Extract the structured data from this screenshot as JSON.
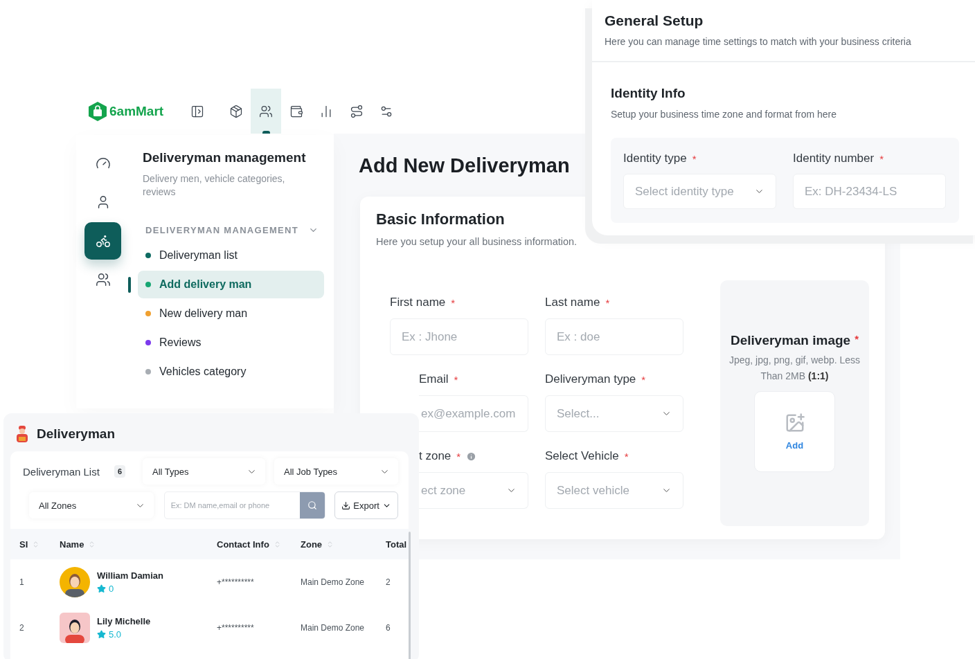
{
  "top_nav": {
    "logo": "6amMart",
    "items": [
      {
        "selected": false
      },
      {
        "selected": false
      },
      {
        "selected": true
      },
      {
        "selected": false
      },
      {
        "selected": false
      },
      {
        "selected": false
      },
      {
        "selected": false
      }
    ]
  },
  "icon_rail": {
    "items": [
      {
        "selected": false
      },
      {
        "selected": false
      },
      {
        "selected": true
      },
      {
        "selected": false
      }
    ]
  },
  "sidebar": {
    "title": "Deliveryman management",
    "subtitle": "Delivery men, vehicle categories, reviews",
    "section": {
      "label": "DELIVERYMAN MANAGEMENT",
      "expanded": true
    },
    "items": [
      {
        "label": "Deliveryman list",
        "color": "#0f6b62",
        "selected": false
      },
      {
        "label": "Add delivery man",
        "color": "#17a673",
        "selected": true
      },
      {
        "label": "New delivery man",
        "color": "#f0a030",
        "selected": false
      },
      {
        "label": "Reviews",
        "color": "#7c3aed",
        "selected": false
      },
      {
        "label": "Vehicles category",
        "color": "#a8adb3",
        "selected": false
      }
    ]
  },
  "form": {
    "title": "Add New Deliveryman",
    "card": {
      "title": "Basic Information",
      "subtitle": "Here you setup your all business information.",
      "fields": [
        {
          "label": "First name",
          "required": "*",
          "kind": "input",
          "placeholder": "Ex : Jhone",
          "clipped": false
        },
        {
          "label": "Last name",
          "required": "*",
          "kind": "input",
          "placeholder": "Ex : doe",
          "clipped": false
        },
        {
          "label": "Email",
          "required": "*",
          "kind": "input",
          "placeholder": "ex@example.com",
          "clipped": true
        },
        {
          "label": "Deliveryman type",
          "required": "*",
          "kind": "select",
          "placeholder": "Select...",
          "clipped": false
        },
        {
          "label": "t zone",
          "required": "*",
          "kind": "select",
          "placeholder": "ect zone",
          "clipped": true,
          "info": true
        },
        {
          "label": "Select Vehicle",
          "required": "*",
          "kind": "select",
          "placeholder": "Select vehicle",
          "clipped": false
        }
      ],
      "image": {
        "label": "Deliveryman image",
        "required": "*",
        "hint": "Jpeg, jpg, png, gif, webp. Less Than 2MB **(1:1)**",
        "button": "Add"
      }
    }
  },
  "general_setup": {
    "title": "General Setup",
    "subtitle": "Here you can manage time settings to match with your business criteria",
    "section": {
      "title": "Identity Info",
      "subtitle": "Setup your business time zone and format from here",
      "fields": [
        {
          "label": "Identity type",
          "required": "*",
          "kind": "select",
          "placeholder": "Select identity type"
        },
        {
          "label": "Identity number",
          "required": "*",
          "kind": "input",
          "placeholder": "Ex: DH-23434-LS"
        }
      ]
    }
  },
  "deliveryman_panel": {
    "title": "Deliveryman",
    "list_title": "Deliveryman List",
    "count": "6",
    "filters": [
      "All Types",
      "All Job Types",
      "All Zones"
    ],
    "search": {
      "placeholder": "Ex: DM name,email or phone"
    },
    "export": "Export",
    "columns": [
      {
        "label": "SI",
        "sortable": true
      },
      {
        "label": "Name",
        "sortable": true
      },
      {
        "label": "Contact Info",
        "sortable": true
      },
      {
        "label": "Zone",
        "sortable": true
      },
      {
        "label": "Total",
        "sortable": false
      }
    ],
    "rows": [
      {
        "si": "1",
        "name": "William Damian",
        "rating": "0",
        "contact": "+**********",
        "zone": "Main Demo Zone",
        "total": "2"
      },
      {
        "si": "2",
        "name": "Lily Michelle",
        "rating": "5.0",
        "contact": "+**********",
        "zone": "Main Demo Zone",
        "total": "6"
      }
    ]
  }
}
